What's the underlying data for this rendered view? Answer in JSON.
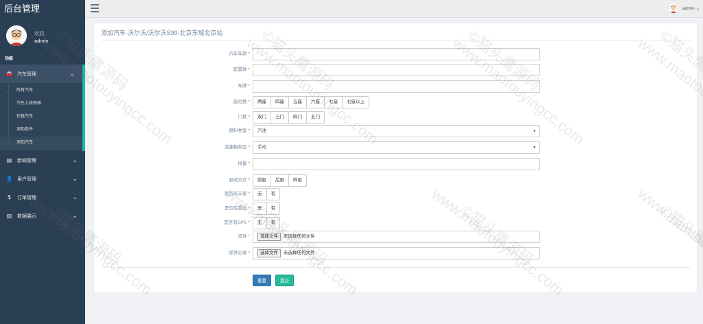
{
  "sidebar": {
    "brand": "后台管理",
    "welcome": "欢迎,",
    "username": "admin",
    "section": "功能",
    "menu": [
      {
        "label": "汽车管理",
        "icon": "car-icon"
      },
      {
        "label": "新闻管理",
        "icon": "newspaper-icon"
      },
      {
        "label": "用户管理",
        "icon": "user-icon"
      },
      {
        "label": "订单管理",
        "icon": "dollar-icon"
      },
      {
        "label": "数据展示",
        "icon": "bar-chart-icon"
      }
    ],
    "submenu": [
      "所有汽车",
      "汽车上线审核",
      "在租汽车",
      "添加条件",
      "添加汽车"
    ]
  },
  "topbar": {
    "user": "admin"
  },
  "form": {
    "title": "添加汽车-沃尔沃/沃尔沃S90-北京东城北京站",
    "year": {
      "label": "汽车年款"
    },
    "config": {
      "label": "配置款"
    },
    "plate": {
      "label": "车牌"
    },
    "seats": {
      "label": "座位数",
      "options": [
        "两座",
        "四座",
        "五座",
        "六座",
        "七座",
        "七座以上"
      ]
    },
    "doors": {
      "label": "门数",
      "options": [
        "双门",
        "三门",
        "四门",
        "五门"
      ]
    },
    "fuel": {
      "label": "燃料类型",
      "value": "汽油"
    },
    "gearbox": {
      "label": "变速箱类型",
      "value": "手动"
    },
    "displacement": {
      "label": "排量"
    },
    "drive": {
      "label": "驱动方式",
      "options": [
        "前驱",
        "后驱",
        "四驱"
      ]
    },
    "sunroof": {
      "label": "是否有天窗",
      "options": [
        "无",
        "有"
      ]
    },
    "radar": {
      "label": "是否有雷达",
      "options": [
        "无",
        "有"
      ]
    },
    "gps": {
      "label": "是否有GPS",
      "options": [
        "无",
        "有"
      ]
    },
    "certificate": {
      "label": "证件"
    },
    "insurance": {
      "label": "保养记录"
    },
    "file_button": "选择文件",
    "file_none": "未选择任何文件",
    "required_mark": "*",
    "reset": "重置",
    "submit": "提交"
  },
  "watermark": {
    "site": "www.maotouyingcc.com",
    "brand": "©猫头鹰源码"
  },
  "colors": {
    "sidebar": "#2a3f54",
    "accent": "#1abb9c",
    "primary": "#337ab7",
    "success": "#26b99a"
  }
}
